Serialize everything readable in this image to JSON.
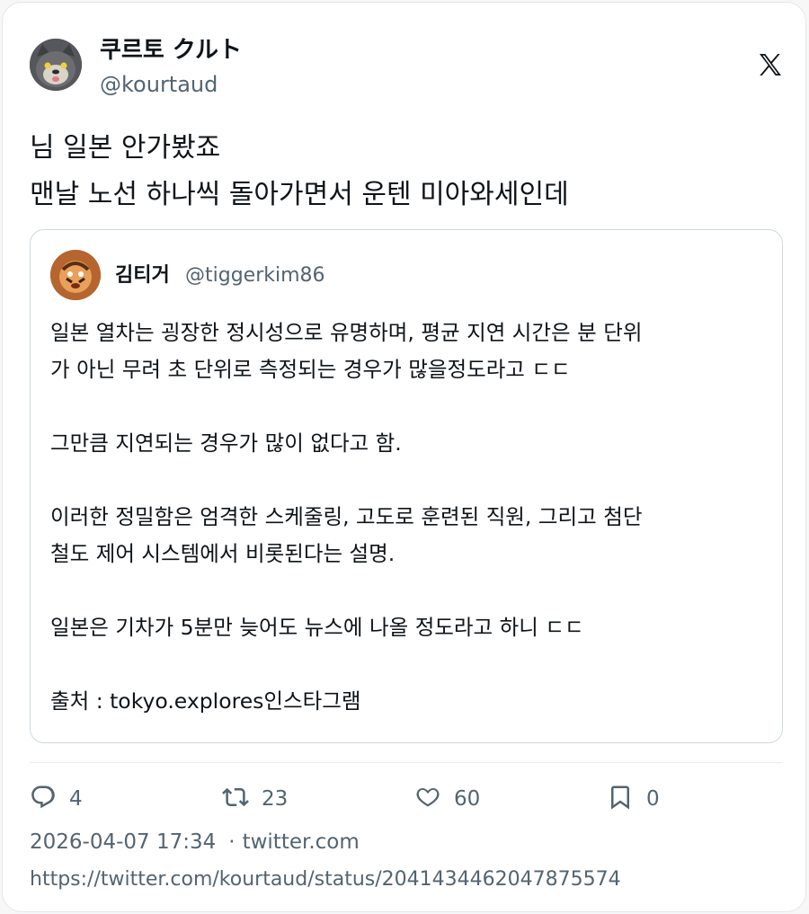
{
  "author": {
    "name": "쿠르토 クルト",
    "handle": "@kourtaud"
  },
  "tweet": {
    "lines": [
      "님 일본 안가봤죠",
      "맨날 노선 하나씩 돌아가면서 운텐 미아와세인데"
    ]
  },
  "quote": {
    "name": "김티거",
    "handle": "@tiggerkim86",
    "lines": [
      "일본 열차는 굉장한 정시성으로 유명하며, 평균 지연 시간은 분 단위",
      "가 아닌 무려 초 단위로 측정되는 경우가 많을정도라고 ㄷㄷ",
      "",
      "그만큼 지연되는 경우가 많이 없다고 함.",
      "",
      "이러한 정밀함은 엄격한 스케줄링, 고도로 훈련된 직원, 그리고 첨단",
      "철도 제어 시스템에서 비롯된다는 설명.",
      "",
      "일본은 기차가 5분만 늦어도 뉴스에 나올 정도라고 하니 ㄷㄷ",
      "",
      "출처 : tokyo.explores인스타그램"
    ]
  },
  "actions": {
    "replies": "4",
    "retweets": "23",
    "likes": "60",
    "bookmarks": "0"
  },
  "meta": {
    "datetime": "2026-04-07 17:34",
    "separator": "·",
    "source": "twitter.com",
    "url": "https://twitter.com/kourtaud/status/2041434462047875574"
  },
  "icons": {
    "reply": "reply-icon",
    "retweet": "retweet-icon",
    "like": "heart-icon",
    "bookmark": "bookmark-icon",
    "brand": "x-logo-icon"
  },
  "colors": {
    "text": "#0f1419",
    "secondary": "#536471",
    "border": "#cfd9de"
  }
}
